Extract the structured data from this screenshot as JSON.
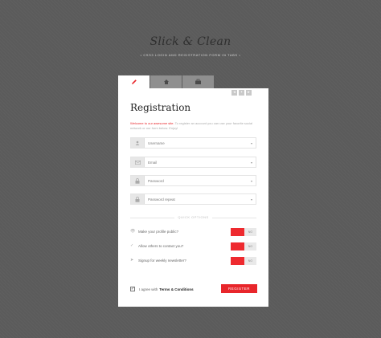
{
  "hero": {
    "title": "Slick & Clean",
    "subtitle": "• CSS3 LOGIN AND REGISTRATION FORM IN TABS •"
  },
  "tabs": [
    {
      "icon": "pencil-icon",
      "active": true
    },
    {
      "icon": "home-icon",
      "active": false
    },
    {
      "icon": "briefcase-icon",
      "active": false
    }
  ],
  "pager": {
    "prev": "◂",
    "pause": "▪",
    "next": "▸"
  },
  "form": {
    "title": "Registration",
    "welcome_accent": "Welcome to our awesome site.",
    "welcome_rest": " To register an account you can use your favorite social network or our form below. Enjoy!",
    "fields": [
      {
        "icon": "user-icon",
        "placeholder": "Username",
        "value": ""
      },
      {
        "icon": "mail-icon",
        "placeholder": "Email",
        "value": ""
      },
      {
        "icon": "lock-icon",
        "placeholder": "Password",
        "value": ""
      },
      {
        "icon": "lock-icon",
        "placeholder": "Password repeat",
        "value": ""
      }
    ],
    "quick_options_label": "QUICK OPTIONS",
    "options": [
      {
        "icon": "eye-icon",
        "label": "Make your profile public?",
        "state": "off",
        "off_label": "NO"
      },
      {
        "icon": "check-icon",
        "label": "Allow others to contact you?",
        "state": "off",
        "off_label": "NO"
      },
      {
        "icon": "send-icon",
        "label": "Signup for weekly newsletter?",
        "state": "off",
        "off_label": "NO"
      }
    ],
    "agree_text": "I agree with",
    "agree_link": "Terms & Conditions",
    "agree_checked": true,
    "register_label": "REGISTER"
  },
  "colors": {
    "background": "#5b5b5b",
    "accent": "#e8262b",
    "card": "#ffffff",
    "tab_inactive": "#8f8f8f"
  }
}
